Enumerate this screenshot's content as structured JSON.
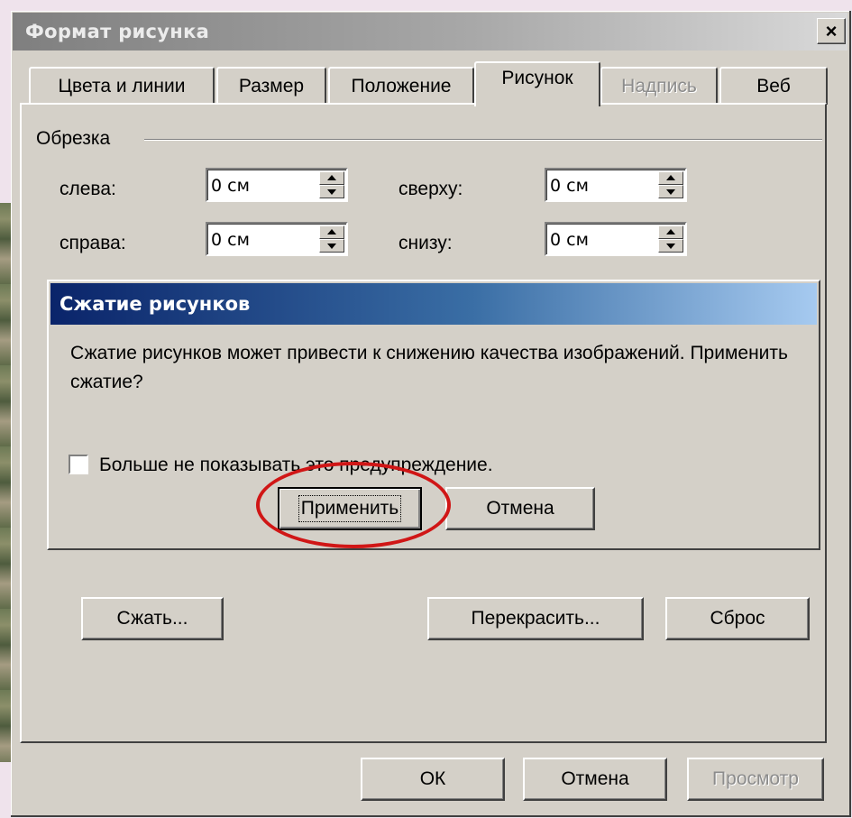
{
  "window": {
    "title": "Формат рисунка",
    "close_label": "×"
  },
  "tabs": [
    {
      "label": "Цвета и линии",
      "state": "normal"
    },
    {
      "label": "Размер",
      "state": "normal"
    },
    {
      "label": "Положение",
      "state": "normal"
    },
    {
      "label": "Рисунок",
      "state": "active"
    },
    {
      "label": "Надпись",
      "state": "disabled"
    },
    {
      "label": "Веб",
      "state": "normal"
    }
  ],
  "crop": {
    "group_label": "Обрезка",
    "left_label": "слева:",
    "left_value": "0 см",
    "right_label": "справа:",
    "right_value": "0 см",
    "top_label": "сверху:",
    "top_value": "0 см",
    "bottom_label": "снизу:",
    "bottom_value": "0 см"
  },
  "compress_dialog": {
    "title": "Сжатие рисунков",
    "message": "Сжатие рисунков может привести к снижению качества изображений. Применить сжатие?",
    "checkbox_label": "Больше не показывать это предупреждение.",
    "checkbox_checked": false,
    "apply_label": "Применить",
    "cancel_label": "Отмена",
    "highlight_color": "#d01616"
  },
  "picture_buttons": {
    "compress": "Сжать...",
    "recolor": "Перекрасить...",
    "reset": "Сброс"
  },
  "footer": {
    "ok": "ОК",
    "cancel": "Отмена",
    "preview": "Просмотр"
  },
  "colors": {
    "face": "#d4d0c8",
    "active_title_start": "#0a246a",
    "active_title_end": "#a6caf0",
    "inactive_title_start": "#7f7f7f"
  }
}
